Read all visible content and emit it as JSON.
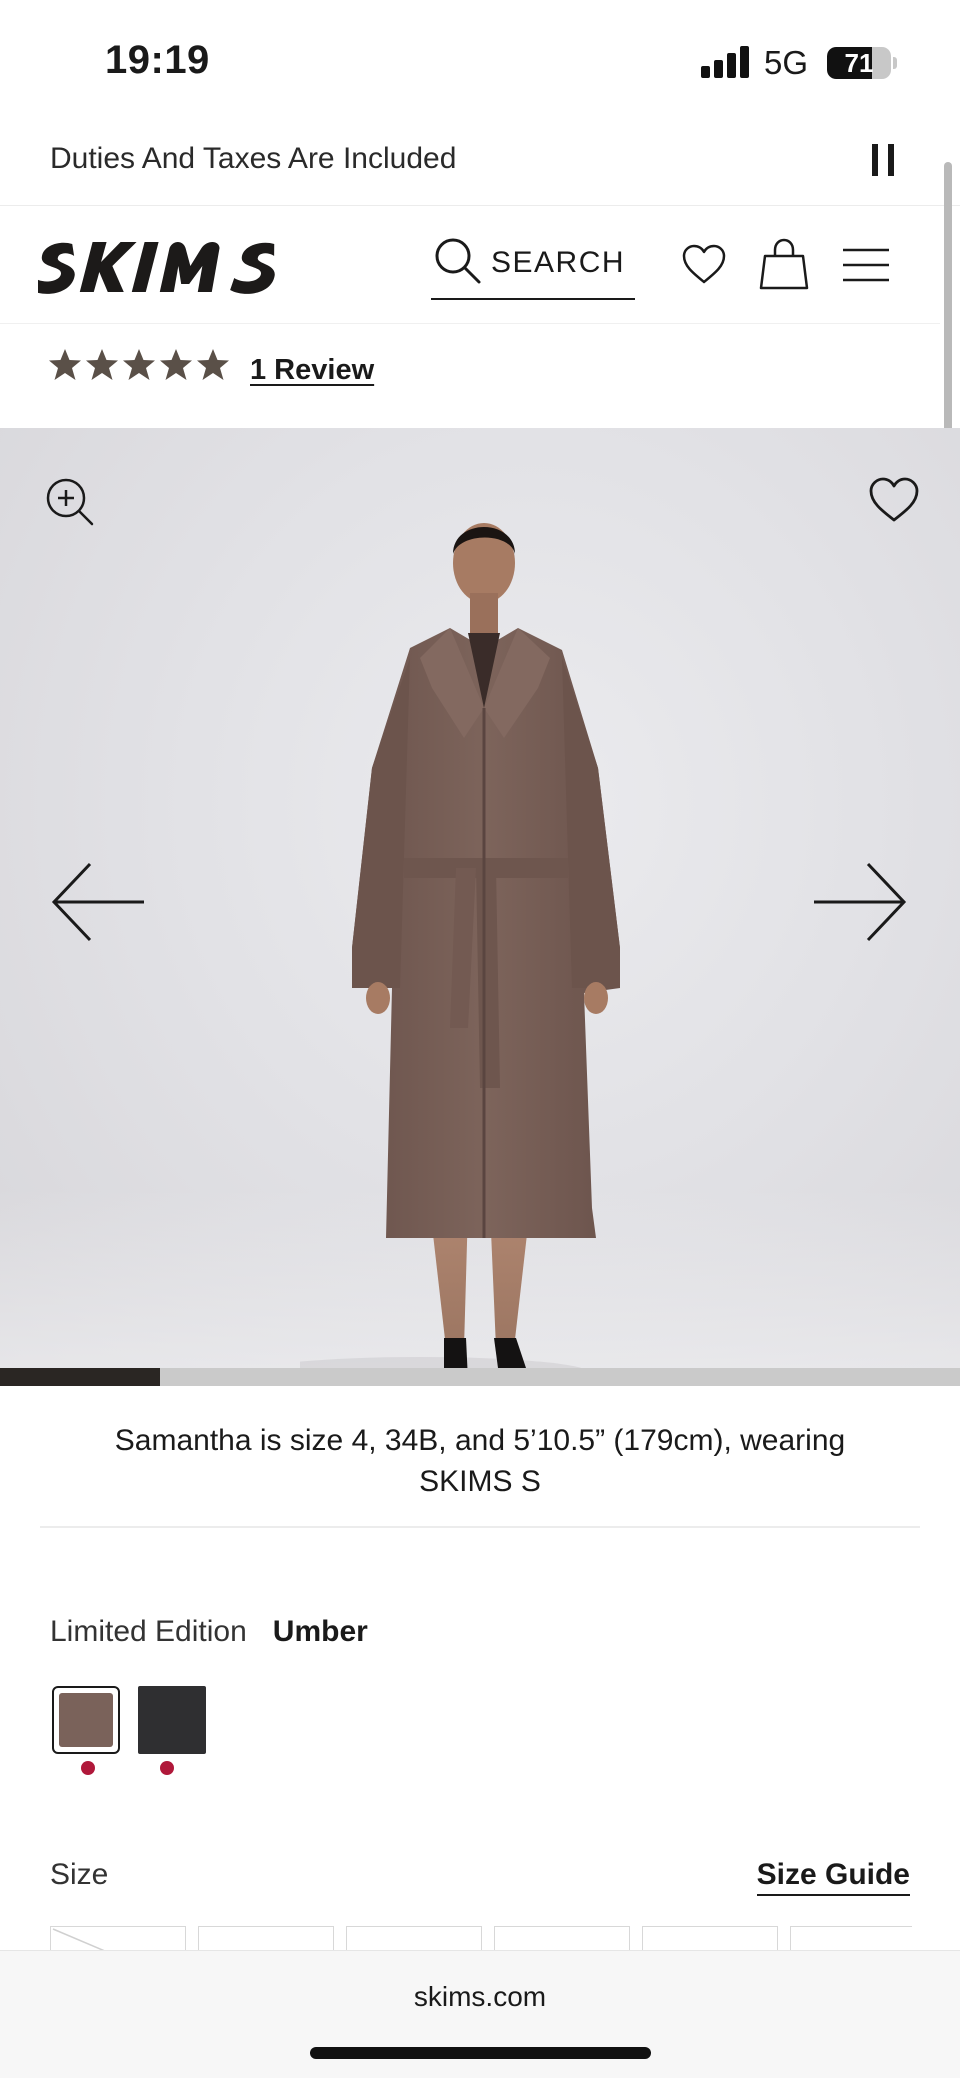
{
  "status_bar": {
    "time": "19:19",
    "network": "5G",
    "battery": "71",
    "battery_level": 0.71
  },
  "announcement": {
    "text": "Duties And Taxes Are Included",
    "pause_icon": "pause-icon"
  },
  "header": {
    "logo_text": "SKIMS",
    "search_label": "SEARCH",
    "icons": [
      "search-icon",
      "heart-icon",
      "bag-icon",
      "menu-icon"
    ]
  },
  "rating": {
    "stars": 5,
    "review_link": "1 Review"
  },
  "gallery": {
    "icons": [
      "zoom-in-icon",
      "heart-icon",
      "arrow-left-icon",
      "arrow-right-icon"
    ],
    "progress": 0.167
  },
  "model_info": {
    "line1": "Samantha is size 4, 34B, and 5’10.5” (179cm), wearing",
    "line2": "SKIMS S"
  },
  "color": {
    "label": "Limited Edition",
    "value": "Umber",
    "swatches": [
      {
        "name": "Umber",
        "color": "#7a625a",
        "selected": true
      },
      {
        "name": "Black",
        "color": "#2f2f31",
        "selected": false
      }
    ],
    "dot_color": "#b0183a"
  },
  "size": {
    "label": "Size",
    "guide_link": "Size Guide"
  },
  "browser": {
    "url": "skims.com"
  }
}
